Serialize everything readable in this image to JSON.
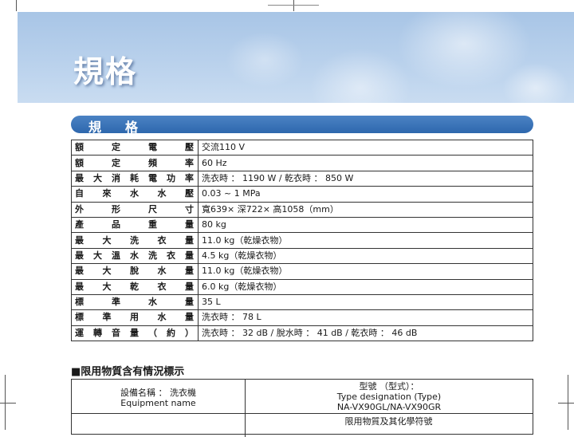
{
  "banner": {
    "title": "規格"
  },
  "section_header": {
    "title": "規格"
  },
  "spec_rows": [
    {
      "label": "額定電壓",
      "value": "交流110 V"
    },
    {
      "label": "額定頻率",
      "value": "60 Hz"
    },
    {
      "label": "最大消耗電功率",
      "value": "洗衣時 ： 1190 W / 乾衣時 ： 850 W"
    },
    {
      "label": "自來水水壓",
      "value": "0.03 ~ 1 MPa"
    },
    {
      "label": "外形尺寸",
      "value": "寬639× 深722× 高1058（mm）"
    },
    {
      "label": "產品重量",
      "value": "80 kg"
    },
    {
      "label": "最大洗衣量",
      "value": "11.0 kg（乾燥衣物）"
    },
    {
      "label": "最大溫水洗衣量",
      "value": "4.5 kg（乾燥衣物）"
    },
    {
      "label": "最大脫水量",
      "value": "11.0 kg（乾燥衣物）"
    },
    {
      "label": "最大乾衣量",
      "value": "6.0 kg（乾燥衣物）"
    },
    {
      "label": "標準水量",
      "value": "35 L"
    },
    {
      "label": "標準用水量",
      "value": "洗衣時 ： 78 L"
    },
    {
      "label": "運轉音量（約）",
      "value": "洗衣時 ： 32 dB / 脫水時 ： 41 dB / 乾衣時 ： 46 dB"
    }
  ],
  "restricted": {
    "heading": "■限用物質含有情況標示",
    "equipment_label_zh": "設備名稱 ： 洗衣機",
    "equipment_label_en": "Equipment name",
    "type_label_zh": "型號 （型式）：",
    "type_label_en": "Type designation (Type)",
    "models": "NA-VX90GL/NA-VX90GR",
    "substances_zh": "限用物質及其化學符號"
  }
}
